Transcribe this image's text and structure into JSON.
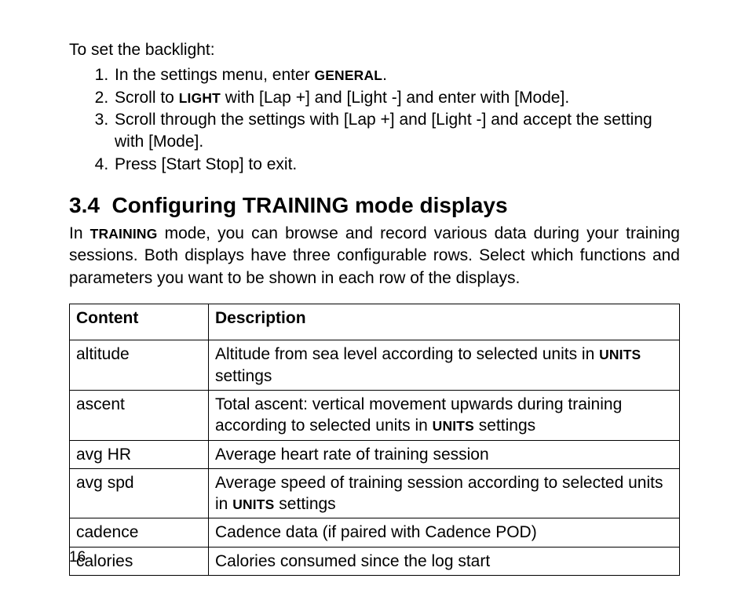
{
  "backlight": {
    "lead": "To set the backlight:",
    "steps": [
      {
        "pre": "In the settings menu, enter ",
        "sc": "GENERAL",
        "post": "."
      },
      {
        "pre": "Scroll to ",
        "sc": "LIGHT",
        "post": " with [Lap +] and [Light -] and enter with [Mode]."
      },
      {
        "pre": "Scroll through the settings with [Lap +] and [Light -] and accept the setting with [Mode].",
        "sc": "",
        "post": ""
      },
      {
        "pre": "Press [Start Stop] to exit.",
        "sc": "",
        "post": ""
      }
    ]
  },
  "section": {
    "number": "3.4",
    "title": "Configuring TRAINING mode displays",
    "intro_pre": "In ",
    "intro_sc": "TRAINING",
    "intro_post": " mode, you can browse and record various data during your training sessions. Both displays have three configurable rows. Select which functions and parameters you want to be shown in each row of the displays."
  },
  "table": {
    "headers": {
      "content": "Content",
      "description": "Description"
    },
    "rows": [
      {
        "content": "altitude",
        "d1": "Altitude from sea level according to selected units in ",
        "sc": "UNITS",
        "d2": " settings"
      },
      {
        "content": "ascent",
        "d1": "Total ascent: vertical movement upwards during training according to selected units in ",
        "sc": "UNITS",
        "d2": " settings"
      },
      {
        "content": "avg HR",
        "d1": "Average heart rate of training session",
        "sc": "",
        "d2": ""
      },
      {
        "content": "avg spd",
        "d1": "Average speed of training session according to selected units in ",
        "sc": "UNITS",
        "d2": " settings"
      },
      {
        "content": "cadence",
        "d1": "Cadence data (if paired with Cadence POD)",
        "sc": "",
        "d2": ""
      },
      {
        "content": "calories",
        "d1": "Calories consumed since the log start",
        "sc": "",
        "d2": ""
      }
    ]
  },
  "page_number": "16"
}
